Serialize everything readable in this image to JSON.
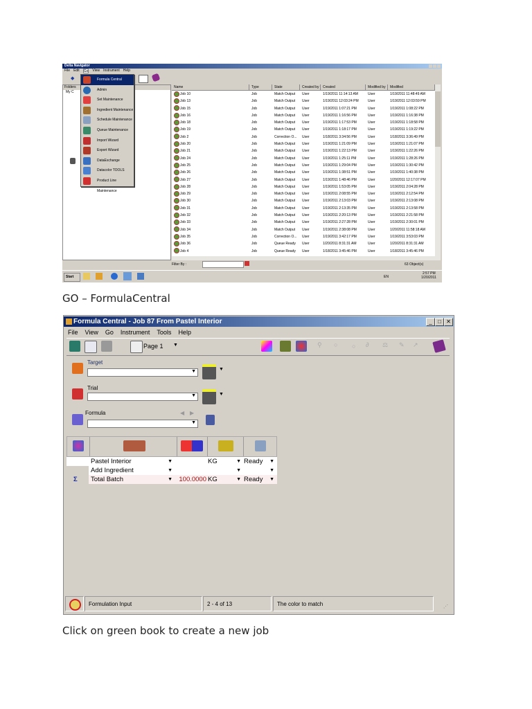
{
  "nav": {
    "title": "Delta Navigator",
    "menu": [
      "File",
      "Edit",
      "Go",
      "View",
      "Instrument",
      "Help"
    ],
    "folders_label": "Folders",
    "tree_root": "My C",
    "go_menu": [
      {
        "label": "Formula Central",
        "selected": true
      },
      {
        "label": "Admin"
      },
      {
        "label": "Set Maintenance"
      },
      {
        "label": "Ingredient Maintenance"
      },
      {
        "label": "Schedule Maintenance"
      },
      {
        "label": "Queue Maintenance"
      },
      {
        "label": "Import Wizard"
      },
      {
        "label": "Export Wizard"
      },
      {
        "label": "DataExchange"
      },
      {
        "label": "Datacolor TOOLS"
      },
      {
        "label": "Product Line Maintenance"
      }
    ],
    "columns": [
      "Name",
      "Type",
      "State",
      "Created by",
      "Created",
      "Modified by",
      "Modified"
    ],
    "rows": [
      [
        "Job 10",
        "Job",
        "Match Output",
        "User",
        "1/19/2011 11:14:13 AM",
        "User",
        "1/19/2011 11:48:49 AM"
      ],
      [
        "Job 13",
        "Job",
        "Match Output",
        "User",
        "1/19/2011 12:03:24 PM",
        "User",
        "1/19/2011 12:03:59 PM"
      ],
      [
        "Job 15",
        "Job",
        "Match Output",
        "User",
        "1/19/2011 1:07:21 PM",
        "User",
        "1/19/2011 1:08:22 PM"
      ],
      [
        "Job 16",
        "Job",
        "Match Output",
        "User",
        "1/19/2011 1:16:56 PM",
        "User",
        "1/19/2011 1:16:38 PM"
      ],
      [
        "Job 18",
        "Job",
        "Match Output",
        "User",
        "1/19/2011 1:17:53 PM",
        "User",
        "1/19/2011 1:18:58 PM"
      ],
      [
        "Job 19",
        "Job",
        "Match Output",
        "User",
        "1/19/2011 1:18:17 PM",
        "User",
        "1/19/2011 1:19:22 PM"
      ],
      [
        "Job 2",
        "Job",
        "Correction O...",
        "User",
        "1/18/2011 3:34:56 PM",
        "User",
        "1/18/2011 3:36:49 PM"
      ],
      [
        "Job 20",
        "Job",
        "Match Output",
        "User",
        "1/19/2011 1:21:09 PM",
        "User",
        "1/19/2011 1:21:07 PM"
      ],
      [
        "Job 21",
        "Job",
        "Match Output",
        "User",
        "1/19/2011 1:22:13 PM",
        "User",
        "1/19/2011 1:22:26 PM"
      ],
      [
        "Job 24",
        "Job",
        "Match Output",
        "User",
        "1/19/2011 1:25:11 PM",
        "User",
        "1/19/2011 1:28:26 PM"
      ],
      [
        "Job 25",
        "Job",
        "Match Output",
        "User",
        "1/19/2011 1:29:04 PM",
        "User",
        "1/19/2011 1:30:42 PM"
      ],
      [
        "Job 26",
        "Job",
        "Match Output",
        "User",
        "1/19/2011 1:38:51 PM",
        "User",
        "1/19/2011 1:40:38 PM"
      ],
      [
        "Job 27",
        "Job",
        "Match Output",
        "User",
        "1/19/2011 1:48:46 PM",
        "User",
        "1/20/2011 12:17:07 PM"
      ],
      [
        "Job 28",
        "Job",
        "Match Output",
        "User",
        "1/19/2011 1:53:05 PM",
        "User",
        "1/19/2011 2:04:28 PM"
      ],
      [
        "Job 29",
        "Job",
        "Match Output",
        "User",
        "1/19/2011 2:08:55 PM",
        "User",
        "1/19/2011 2:12:54 PM"
      ],
      [
        "Job 30",
        "Job",
        "Match Output",
        "User",
        "1/19/2011 2:13:03 PM",
        "User",
        "1/19/2011 2:13:08 PM"
      ],
      [
        "Job 31",
        "Job",
        "Match Output",
        "User",
        "1/19/2011 2:13:35 PM",
        "User",
        "1/19/2011 2:13:58 PM"
      ],
      [
        "Job 32",
        "Job",
        "Match Output",
        "User",
        "1/19/2011 2:20:13 PM",
        "User",
        "1/19/2011 2:21:58 PM"
      ],
      [
        "Job 33",
        "Job",
        "Match Output",
        "User",
        "1/19/2011 2:27:28 PM",
        "User",
        "1/19/2011 2:30:01 PM"
      ],
      [
        "Job 34",
        "Job",
        "Match Output",
        "User",
        "1/19/2011 2:38:08 PM",
        "User",
        "1/20/2011 11:58:18 AM"
      ],
      [
        "Job 35",
        "Job",
        "Correction O...",
        "User",
        "1/19/2011 3:42:17 PM",
        "User",
        "1/19/2011 3:53:03 PM"
      ],
      [
        "Job 36",
        "Job",
        "Queue Ready",
        "User",
        "1/20/2011 8:31:31 AM",
        "User",
        "1/20/2011 8:31:31 AM"
      ],
      [
        "Job 4",
        "Job",
        "Queue Ready",
        "User",
        "1/18/2011 3:45:46 PM",
        "User",
        "1/18/2011 3:45:46 PM"
      ]
    ],
    "filter_label": "Filter By :",
    "filter_value": "",
    "object_count": "63 Object(s)",
    "start_label": "Start",
    "tray_lang": "EN",
    "tray_time": "2:57 PM",
    "tray_date": "1/20/2011"
  },
  "caption1": "GO – FormulaCentral",
  "fc": {
    "title": "Formula Central  -  Job 87 From Pastel Interior",
    "menu": [
      "File",
      "View",
      "Go",
      "Instrument",
      "Tools",
      "Help"
    ],
    "page_select": "Page 1",
    "target_label": "Target",
    "trial_label": "Trial",
    "formula_label": "Formula",
    "target_value": "",
    "trial_value": "",
    "formula_value": "",
    "rows": [
      {
        "name": "Pastel Interior",
        "amount": "",
        "unit": "KG",
        "status": "Ready"
      },
      {
        "name": "Add Ingredient",
        "amount": "",
        "unit": "",
        "status": ""
      },
      {
        "name": "Total Batch",
        "amount": "100.0000",
        "unit": "KG",
        "status": "Ready"
      }
    ],
    "sigma": "Σ",
    "status": {
      "mode": "Formulation Input",
      "range": "2 - 4 of 13",
      "hint": "The color to match"
    }
  },
  "caption2": "Click on green book to create a new job"
}
